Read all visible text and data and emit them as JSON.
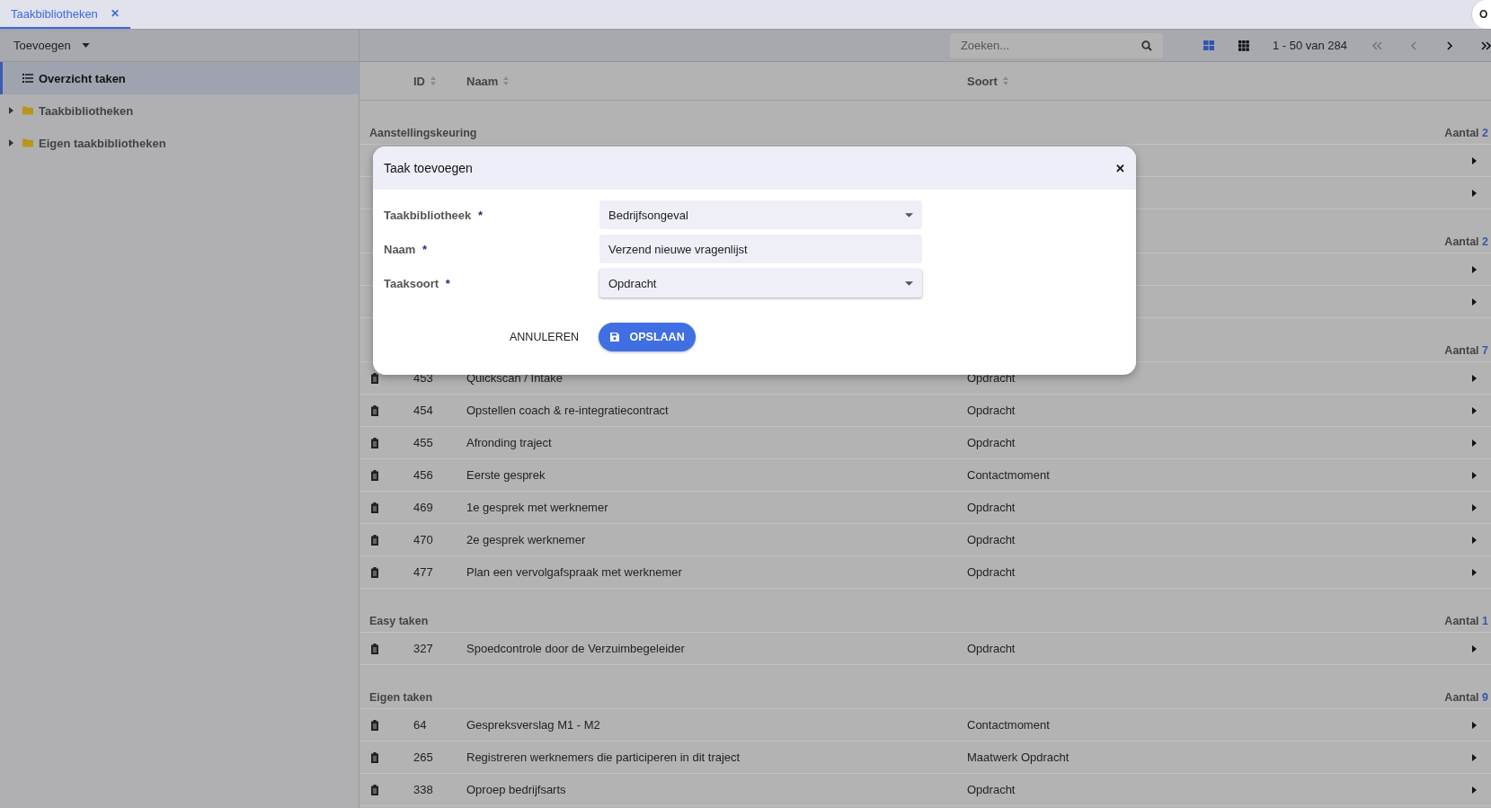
{
  "tabs": [
    {
      "label": "Taakbibliotheken",
      "selected": true,
      "close": "✕"
    }
  ],
  "avatar": {
    "text": "O"
  },
  "sidebar": {
    "add_button": "Toevoegen",
    "items": [
      {
        "label": "Overzicht taken",
        "kind": "list",
        "selected": true
      },
      {
        "label": "Taakbibliotheken",
        "kind": "folder",
        "selected": false,
        "expanded": false
      },
      {
        "label": "Eigen taakbibliotheken",
        "kind": "folder",
        "selected": false,
        "expanded": false
      }
    ]
  },
  "toolbar": {
    "search": {
      "placeholder": "Zoeken..."
    },
    "views": [
      {
        "kind": "tiles",
        "selected": true
      },
      {
        "kind": "grid",
        "selected": false
      }
    ],
    "range": "1 - 50 van 284",
    "pager": [
      {
        "kind": "first",
        "disabled": true
      },
      {
        "kind": "prev",
        "disabled": true
      },
      {
        "kind": "next",
        "disabled": false
      },
      {
        "kind": "last",
        "disabled": false
      }
    ]
  },
  "table": {
    "columns": [
      "ID",
      "Naam",
      "Soort"
    ],
    "groups": [
      {
        "title": "Aanstellingskeuring",
        "count_label": "Aantal",
        "count": "2",
        "rows": [
          {
            "kind": "covered"
          },
          {
            "kind": "covered"
          }
        ]
      },
      {
        "count_label": "Aantal",
        "count": "2",
        "rows": [
          {
            "kind": "covered"
          },
          {
            "kind": "covered"
          }
        ]
      },
      {
        "count_label": "Aantal",
        "count": "7",
        "rows": [
          {
            "kind": "task",
            "id": "453",
            "name": "Quickscan / Intake",
            "type": "Opdracht"
          },
          {
            "kind": "task",
            "id": "454",
            "name": "Opstellen coach & re-integratiecontract",
            "type": "Opdracht"
          },
          {
            "kind": "task",
            "id": "455",
            "name": "Afronding traject",
            "type": "Opdracht"
          },
          {
            "kind": "task",
            "id": "456",
            "name": "Eerste gesprek",
            "type": "Contactmoment"
          },
          {
            "kind": "task",
            "id": "469",
            "name": "1e gesprek met werknemer",
            "type": "Opdracht"
          },
          {
            "kind": "task",
            "id": "470",
            "name": "2e gesprek werknemer",
            "type": "Opdracht"
          },
          {
            "kind": "task",
            "id": "477",
            "name": "Plan een vervolgafspraak met werknemer",
            "type": "Opdracht"
          }
        ]
      },
      {
        "title": "Easy taken",
        "count_label": "Aantal",
        "count": "1",
        "rows": [
          {
            "kind": "task",
            "id": "327",
            "name": "Spoedcontrole door de Verzuimbegeleider",
            "type": "Opdracht"
          }
        ]
      },
      {
        "title": "Eigen taken",
        "count_label": "Aantal",
        "count": "9",
        "rows": [
          {
            "kind": "task",
            "id": "64",
            "name": "Gespreksverslag M1 - M2",
            "type": "Contactmoment"
          },
          {
            "kind": "task",
            "id": "265",
            "name": "Registreren werknemers die participeren in dit traject",
            "type": "Maatwerk Opdracht"
          },
          {
            "kind": "task",
            "id": "338",
            "name": "Oproep bedrijfsarts",
            "type": "Opdracht"
          }
        ]
      }
    ]
  },
  "dialog": {
    "title": "Taak toevoegen",
    "close": "✕",
    "fields": [
      {
        "label": "Taakbibliotheek",
        "required": "*",
        "kind": "select",
        "value": "Bedrijfsongeval"
      },
      {
        "label": "Naam",
        "required": "*",
        "kind": "text",
        "value": "Verzend nieuwe vragenlijst"
      },
      {
        "label": "Taaksoort",
        "required": "*",
        "kind": "select",
        "value": "Opdracht"
      }
    ],
    "cancel": "ANNULEREN",
    "save": "OPSLAAN"
  }
}
